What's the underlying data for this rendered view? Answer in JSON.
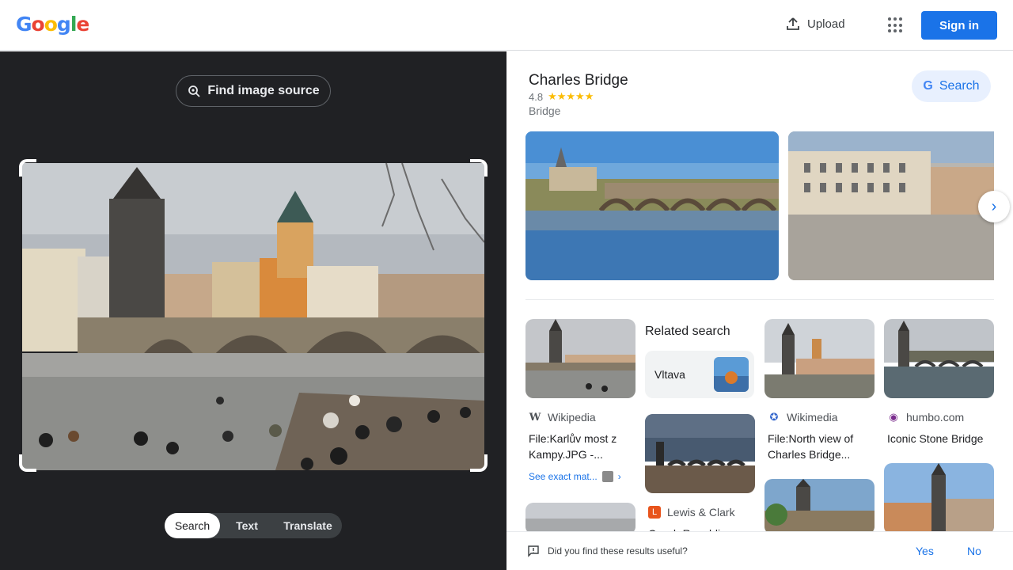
{
  "header": {
    "logo_letters": [
      "G",
      "o",
      "o",
      "g",
      "l",
      "e"
    ],
    "logo_colors": [
      "#4285f4",
      "#ea4335",
      "#fbbc05",
      "#4285f4",
      "#34a853",
      "#ea4335"
    ],
    "upload_label": "Upload",
    "apps_icon": "apps-grid-icon",
    "signin_label": "Sign in"
  },
  "left_panel": {
    "find_source_label": "Find image source",
    "modes": [
      "Search",
      "Text",
      "Translate"
    ],
    "active_mode": "Search"
  },
  "entity": {
    "title": "Charles Bridge",
    "rating": "4.8",
    "stars": "★★★★★",
    "type": "Bridge",
    "search_label": "Search"
  },
  "results": {
    "related_heading": "Related search",
    "related_chip": "Vltava",
    "items": [
      {
        "source": "Wikipedia",
        "caption": "File:Karlův most z Kampy.JPG -...",
        "icon": "wikipedia-icon"
      },
      {
        "source": "Wikimedia",
        "caption": "File:North view of Charles Bridge...",
        "icon": "wikimedia-icon"
      },
      {
        "source": "humbo.com",
        "caption": "Iconic Stone Bridge",
        "icon": "humbo-icon"
      },
      {
        "source": "Lewis & Clark",
        "caption": "Czech Republi...",
        "icon": "lewis-clark-icon"
      }
    ],
    "see_exact": "See exact mat..."
  },
  "feedback": {
    "question": "Did you find these results useful?",
    "yes": "Yes",
    "no": "No"
  },
  "colors": {
    "accent": "#1a73e8",
    "dark_panel": "#202124"
  }
}
